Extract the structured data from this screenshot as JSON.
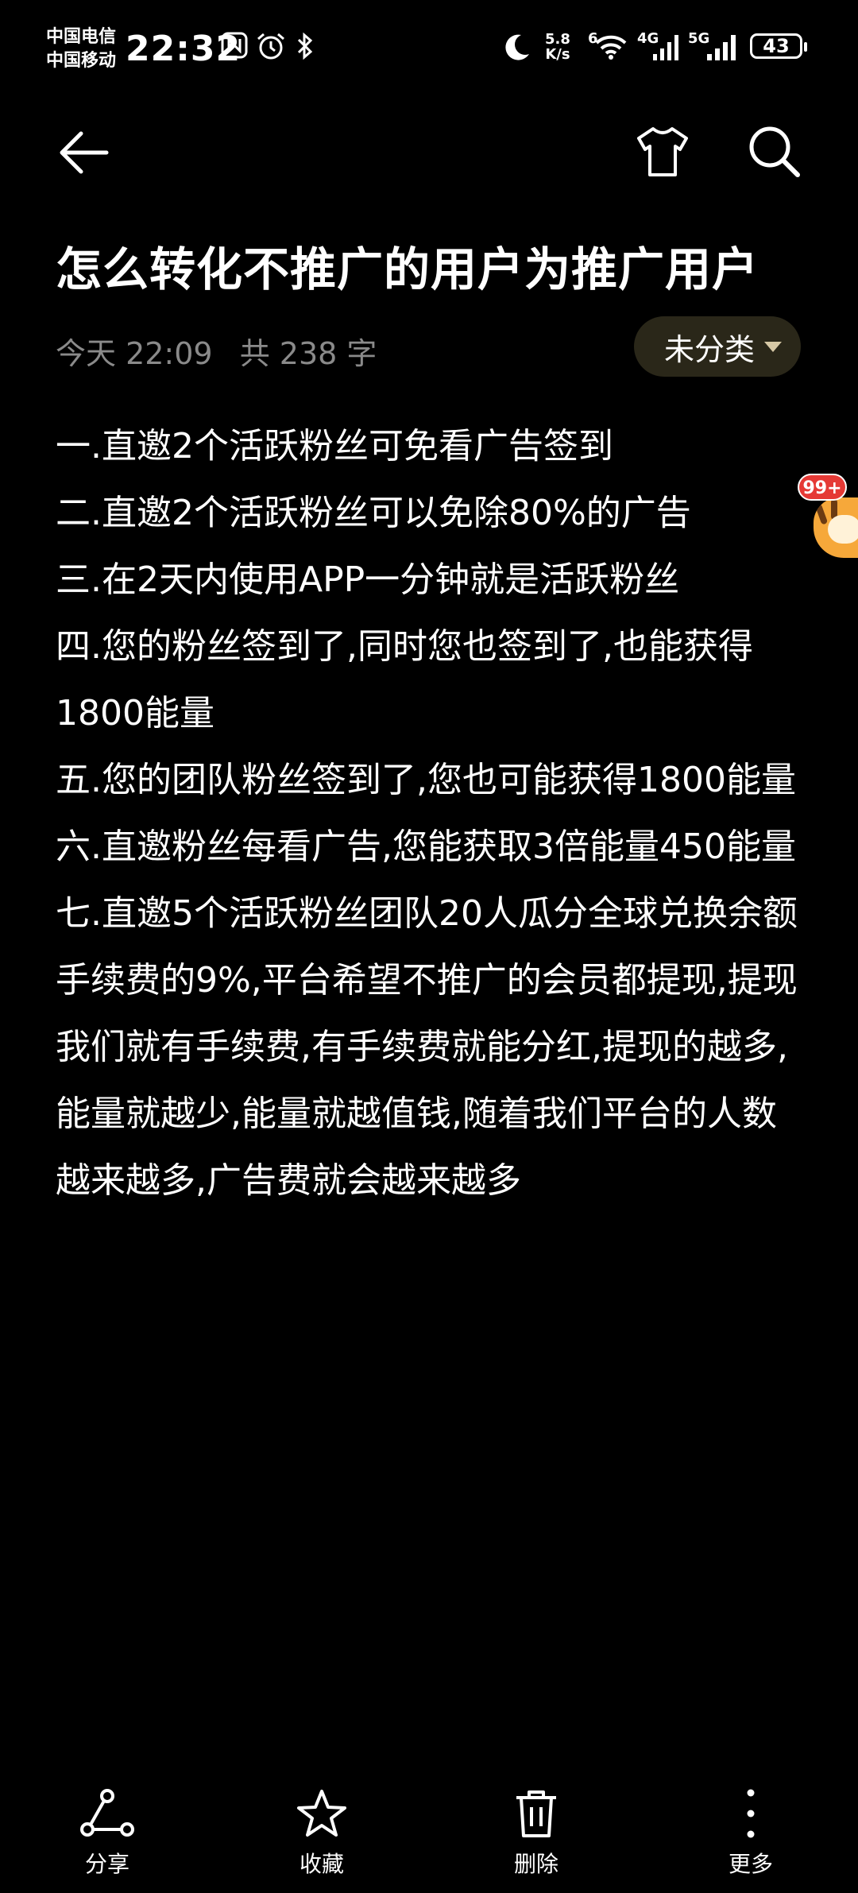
{
  "status_bar": {
    "carrier_1": "中国电信",
    "carrier_2": "中国移动",
    "time": "22:32",
    "net_speed_value": "5.8",
    "net_speed_unit": "K/s",
    "wifi_label": "6",
    "signal_1_label": "4G",
    "signal_2_label": "5G",
    "battery": "43"
  },
  "toolbar": {
    "back_icon": "arrow-left",
    "theme_icon": "t-shirt",
    "search_icon": "magnifier"
  },
  "note": {
    "title": "怎么转化不推广的用户为推广用户",
    "date": "今天 22:09",
    "word_count": "共 238 字",
    "category": "未分类",
    "paragraphs": [
      "一.直邀2个活跃粉丝可免看广告签到",
      "二.直邀2个活跃粉丝可以免除80%的广告",
      "三.在2天内使用APP一分钟就是活跃粉丝",
      "四.您的粉丝签到了,同时您也签到了,也能获得1800能量",
      "五.您的团队粉丝签到了,您也可能获得1800能量",
      "六.直邀粉丝每看广告,您能获取3倍能量450能量",
      "七.直邀5个活跃粉丝团队20人瓜分全球兑换余额手续费的9%,平台希望不推广的会员都提现,提现我们就有手续费,有手续费就能分红,提现的越多,能量就越少,能量就越值钱,随着我们平台的人数越来越多,广告费就会越来越多"
    ]
  },
  "floating_widget": {
    "badge": "99+"
  },
  "bottom_bar": {
    "share": "分享",
    "favorite": "收藏",
    "delete": "删除",
    "more": "更多"
  },
  "colors": {
    "background": "#000000",
    "text": "#ffffff",
    "meta": "#8a8a8a",
    "category_bg": "#2a2719",
    "badge": "#e53935"
  }
}
